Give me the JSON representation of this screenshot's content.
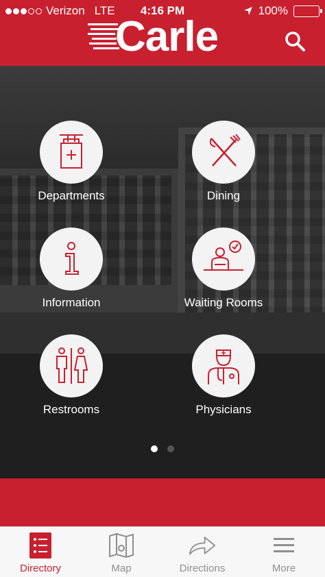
{
  "status_bar": {
    "carrier": "Verizon",
    "network": "LTE",
    "time": "4:16 PM",
    "battery": "100%"
  },
  "header": {
    "logo": "Carle",
    "search_icon": "search-icon"
  },
  "tiles": [
    {
      "label": "Departments",
      "icon": "department-sign-icon"
    },
    {
      "label": "Dining",
      "icon": "fork-knife-icon"
    },
    {
      "label": "Information",
      "icon": "info-icon"
    },
    {
      "label": "Waiting Rooms",
      "icon": "waiting-room-icon"
    },
    {
      "label": "Restrooms",
      "icon": "restroom-icon"
    },
    {
      "label": "Physicians",
      "icon": "physician-icon"
    }
  ],
  "pager": {
    "pages": 2,
    "active": 1
  },
  "tabbar": [
    {
      "label": "Directory",
      "icon": "list-icon",
      "active": true
    },
    {
      "label": "Map",
      "icon": "map-icon",
      "active": false
    },
    {
      "label": "Directions",
      "icon": "arrow-right-icon",
      "active": false
    },
    {
      "label": "More",
      "icon": "menu-icon",
      "active": false
    }
  ],
  "colors": {
    "brand_red": "#c8202f",
    "inactive_gray": "#8e8e8e"
  }
}
